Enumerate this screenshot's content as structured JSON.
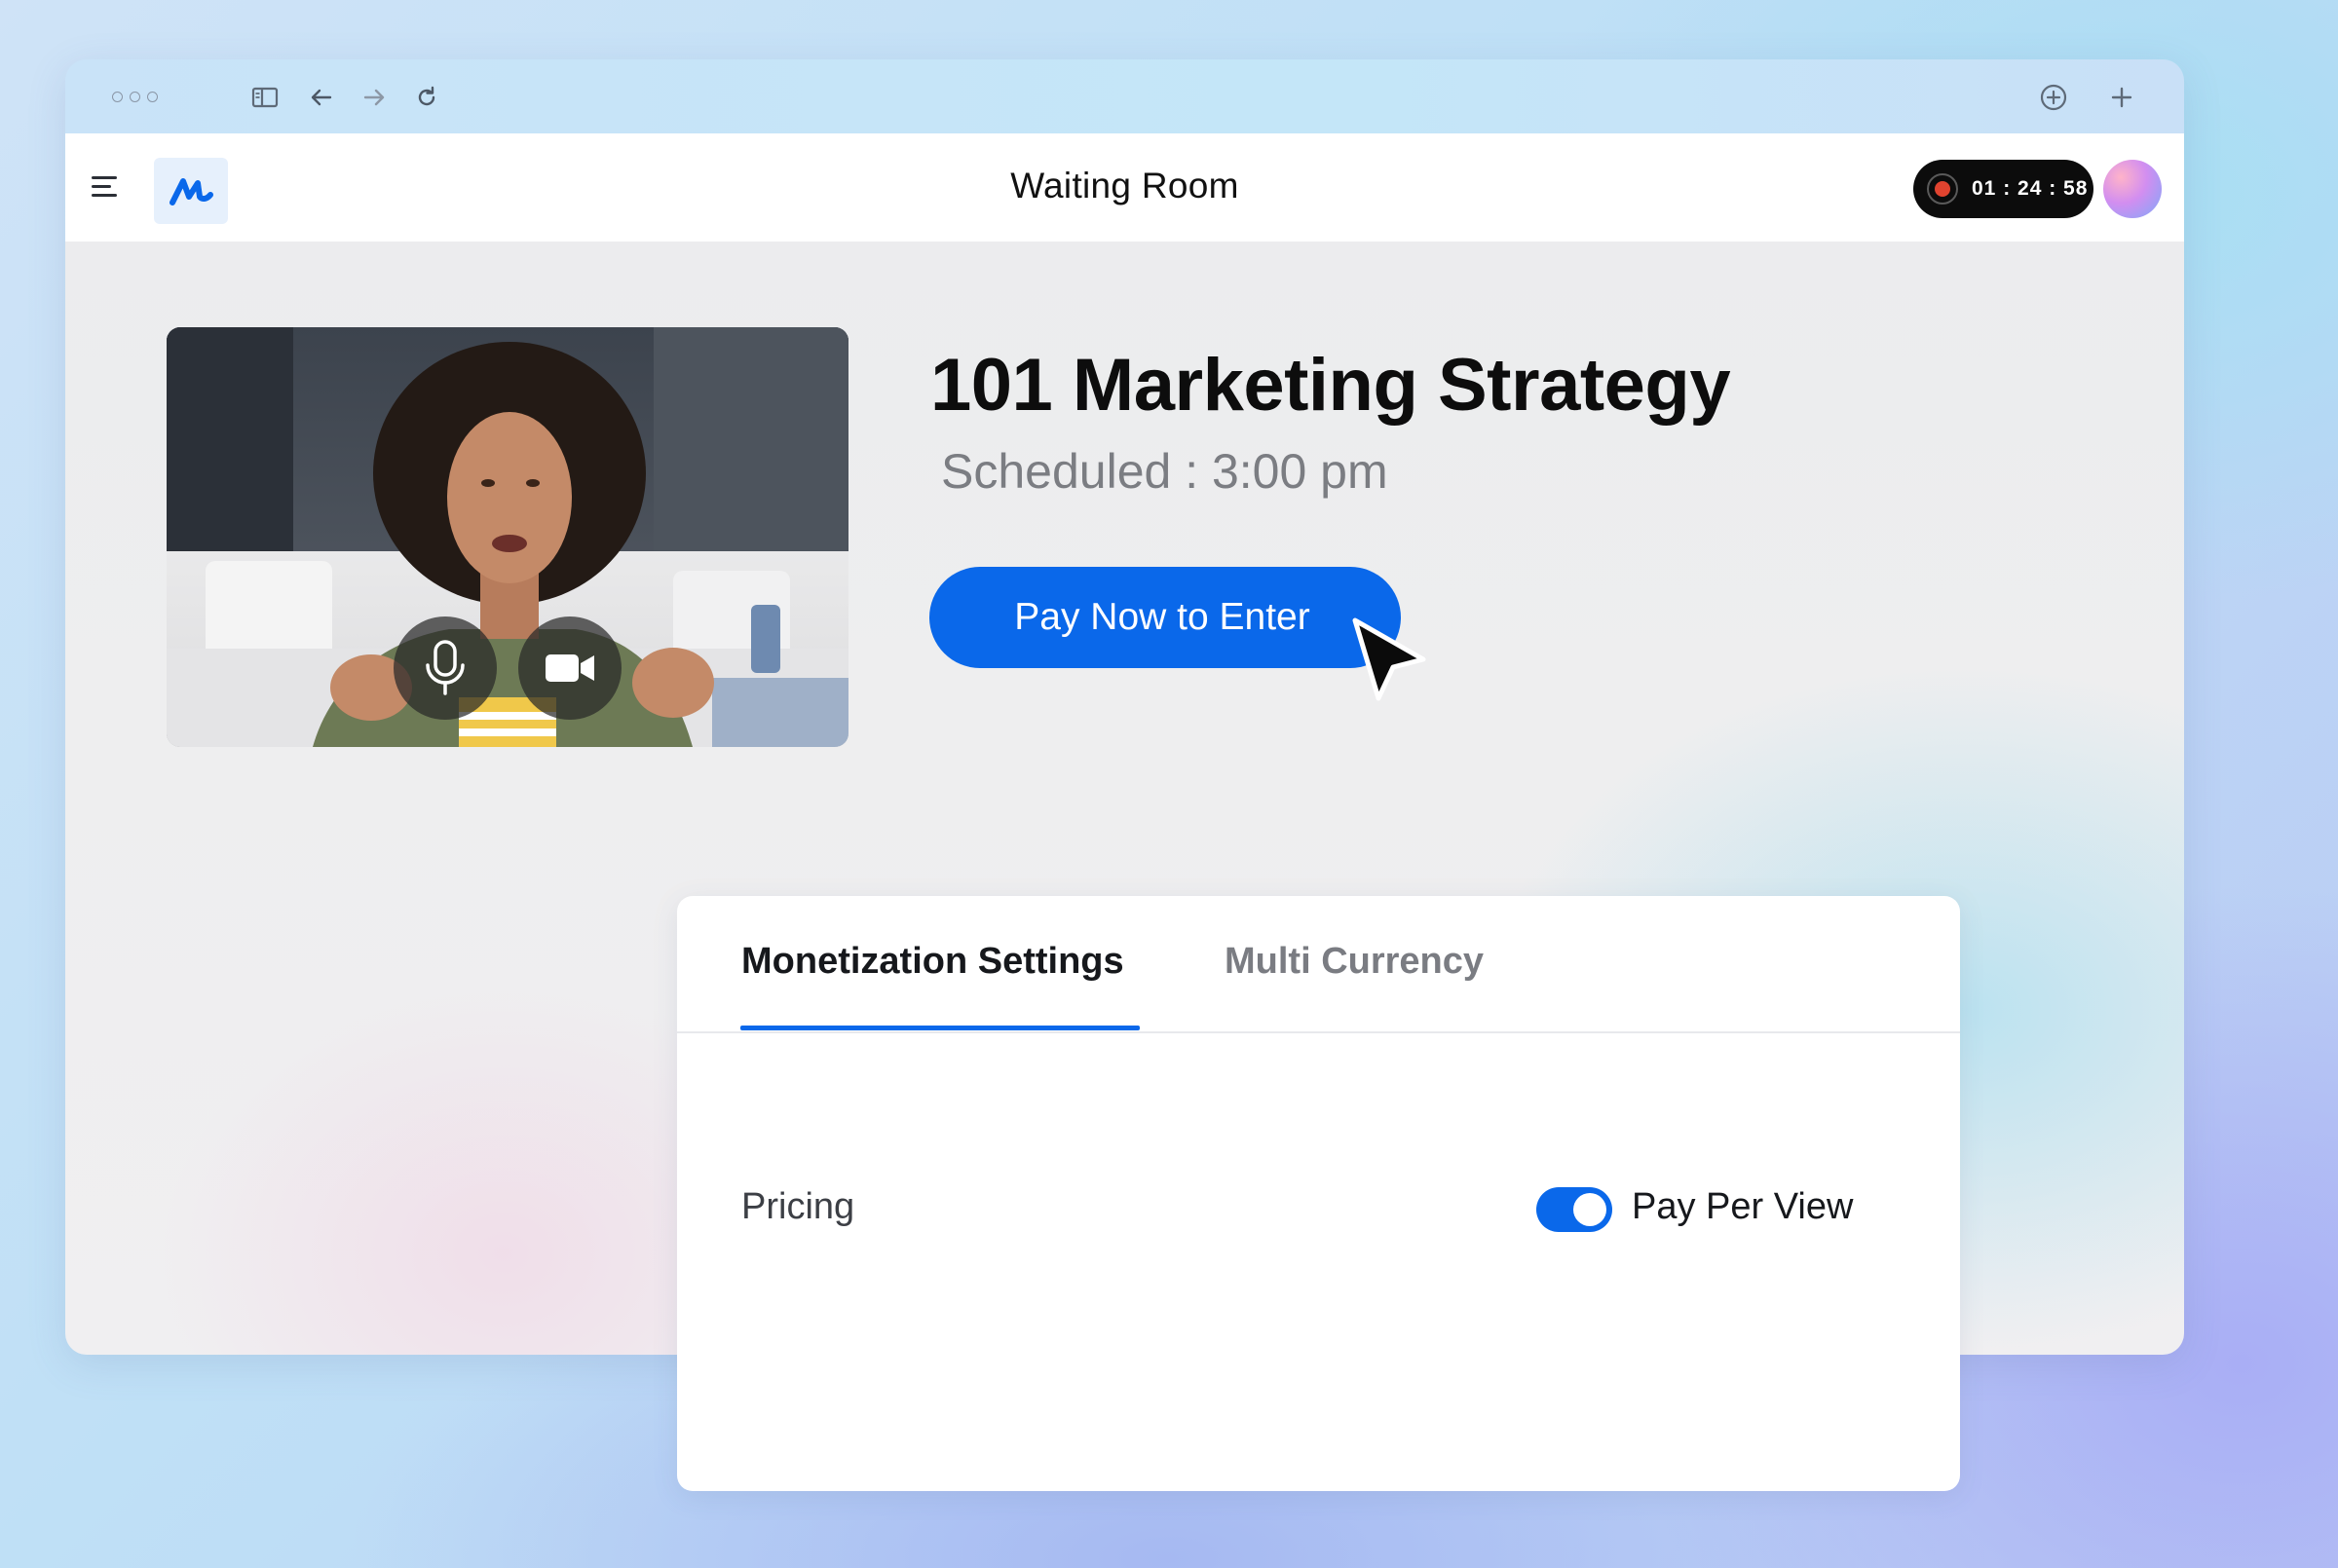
{
  "header": {
    "title": "Waiting Room",
    "timer": "01 : 24 : 58"
  },
  "event": {
    "title": "101 Marketing Strategy",
    "scheduled": "Scheduled : 3:00 pm",
    "cta_label": "Pay Now to Enter"
  },
  "settings": {
    "tabs": [
      {
        "label": "Monetization Settings",
        "active": true
      },
      {
        "label": "Multi Currency",
        "active": false
      }
    ],
    "pricing_label": "Pricing",
    "pay_per_view": {
      "label": "Pay Per View",
      "enabled": true
    }
  },
  "icons": {
    "menu": "hamburger-menu-icon",
    "logo": "brand-logo-icon",
    "mic": "microphone-icon",
    "camera": "video-camera-icon",
    "record": "record-icon",
    "cursor": "mouse-pointer-icon"
  },
  "colors": {
    "accent": "#0a68ea",
    "record": "#e0432f",
    "timer_bg": "#0c0c0c"
  }
}
